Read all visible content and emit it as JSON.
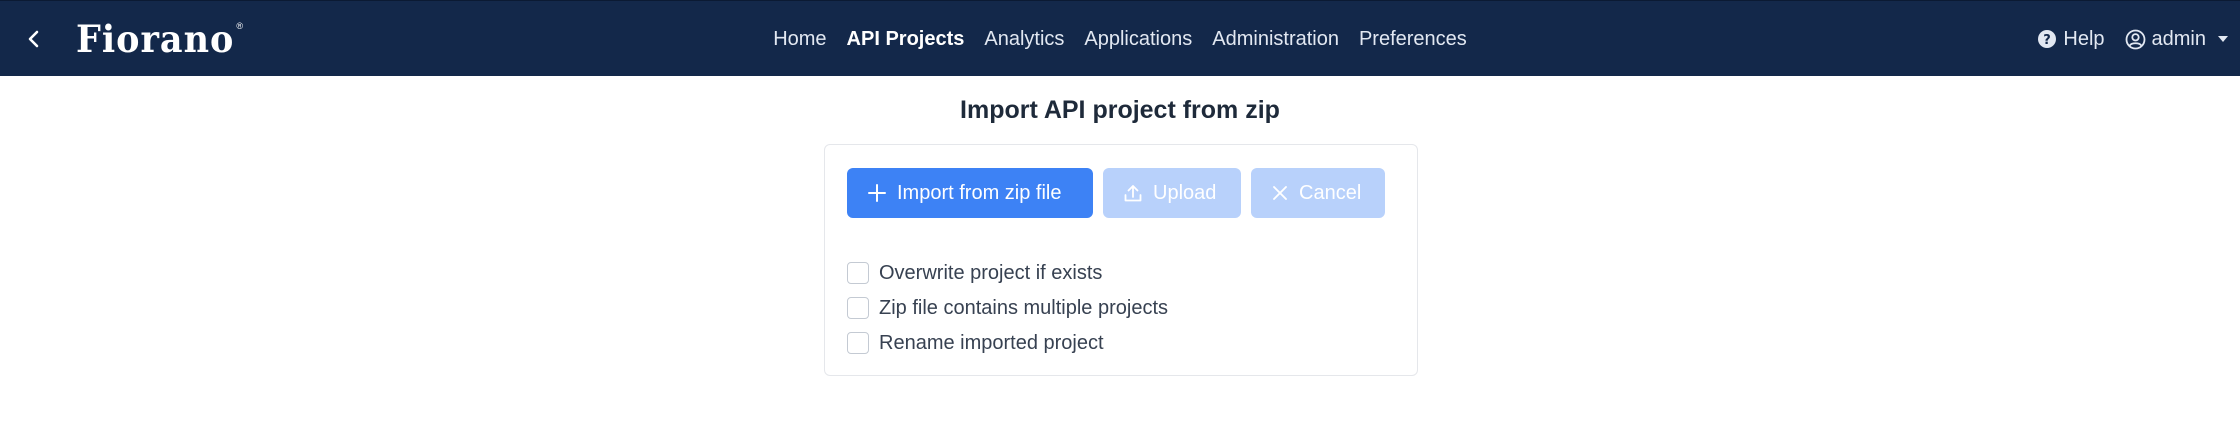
{
  "header": {
    "logo": "Fiorano",
    "logo_mark": "®",
    "nav": [
      {
        "label": "Home"
      },
      {
        "label": "API Projects"
      },
      {
        "label": "Analytics"
      },
      {
        "label": "Applications"
      },
      {
        "label": "Administration"
      },
      {
        "label": "Preferences"
      }
    ],
    "active_nav": "API Projects",
    "help_label": "Help",
    "user_label": "admin",
    "icons": {
      "back": "chevron-left-icon",
      "help": "question-circle-icon",
      "user": "user-circle-icon"
    }
  },
  "page": {
    "title": "Import API project from zip"
  },
  "actions": {
    "import_label": "Import from zip file",
    "upload_label": "Upload",
    "cancel_label": "Cancel",
    "upload_enabled": false,
    "cancel_enabled": false
  },
  "options": [
    {
      "label": "Overwrite project if exists",
      "checked": false
    },
    {
      "label": "Zip file contains multiple projects",
      "checked": false
    },
    {
      "label": "Rename imported project",
      "checked": false
    }
  ],
  "colors": {
    "header_bg": "#13284a",
    "primary": "#3d82f5",
    "primary_disabled": "#b8d1fb"
  }
}
